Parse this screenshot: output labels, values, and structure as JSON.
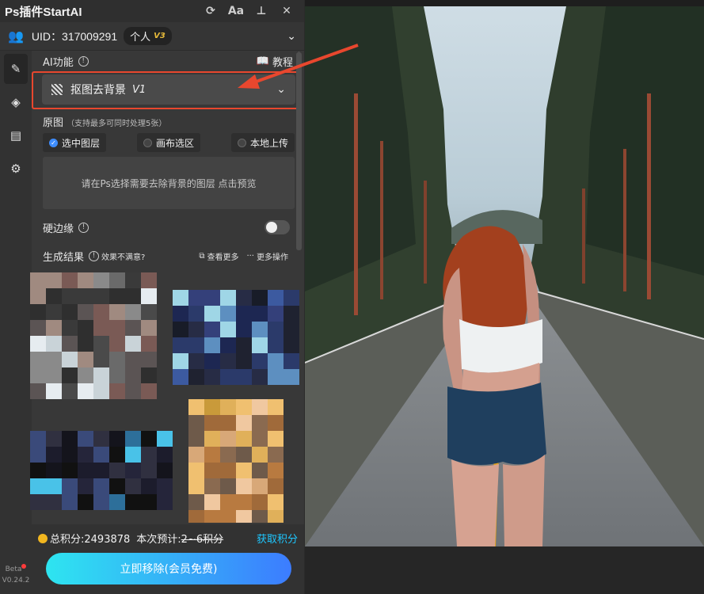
{
  "panel": {
    "app_title": "Ps插件StartAI",
    "toolbar": {
      "refresh_icon": "refresh-icon",
      "font_label": "Aa",
      "pin_icon": "pin-icon",
      "close_label": "✕"
    },
    "user": {
      "uid": "UID：317009291",
      "plan": "个人",
      "vip_level": "V3"
    },
    "ai_features": {
      "label": "AI功能",
      "tutorial": "教程",
      "selected_feature": "抠图去背景",
      "feature_version": "V1"
    },
    "source": {
      "title": "原图",
      "note": "（支持最多可同时处理5张）",
      "options": [
        "选中图层",
        "画布选区",
        "本地上传"
      ],
      "selected_index": 0,
      "placeholder": "请在Ps选择需要去除背景的图层 点击预览"
    },
    "hard_edge": {
      "label": "硬边缘",
      "enabled": false
    },
    "results": {
      "label": "生成结果",
      "unsatisfied": "效果不满意?",
      "view_more": "查看更多",
      "more_actions": "更多操作"
    },
    "footer": {
      "total_points": "总积分:2493878",
      "estimate_label": "本次预计:",
      "estimate_value": "2~6积分",
      "get_points": "获取积分",
      "cta": "立即移除(会员免费)"
    },
    "version": {
      "beta": "Beta",
      "number": "V0.24.2"
    }
  },
  "colors": {
    "highlight": "#e8472e",
    "accent_blue": "#3e8dff",
    "link_cyan": "#1ec7ff",
    "coin": "#f1b61f"
  }
}
